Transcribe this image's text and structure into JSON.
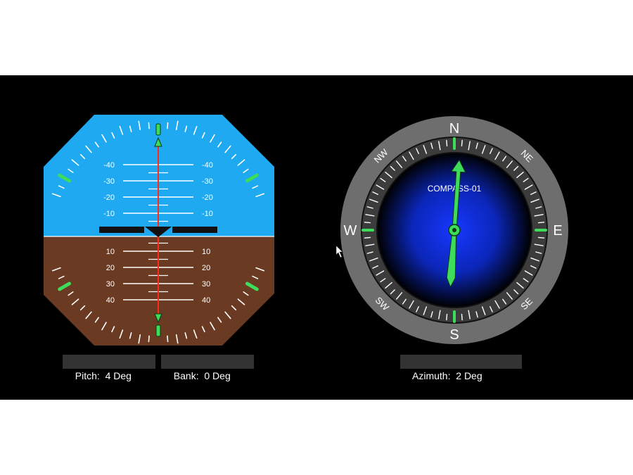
{
  "attitude_indicator": {
    "pitch_labels": [
      "10",
      "20",
      "30",
      "40"
    ],
    "pitch_labels_up": [
      "-10",
      "-20",
      "-30",
      "-40"
    ],
    "pitch_readout_label": "Pitch:",
    "pitch_value": "4 Deg",
    "bank_readout_label": "Bank:",
    "bank_value": "0 Deg",
    "pitch_deg": 4,
    "bank_deg": 0
  },
  "compass": {
    "title": "COMPASS-01",
    "cardinals": {
      "n": "N",
      "s": "S",
      "e": "E",
      "w": "W"
    },
    "intercardinals": {
      "ne": "NE",
      "nw": "NW",
      "se": "SE",
      "sw": "SW"
    },
    "azimuth_readout_label": "Azimuth:",
    "azimuth_value": "2 Deg",
    "azimuth_deg": 2
  },
  "colors": {
    "sky": "#1fa9f0",
    "ground": "#6b3a22",
    "bezel": "#6e6e6e",
    "dial_center": "#0a2fd6",
    "accent_green": "#3ddc5a",
    "needle_red": "#ff2a1a"
  }
}
